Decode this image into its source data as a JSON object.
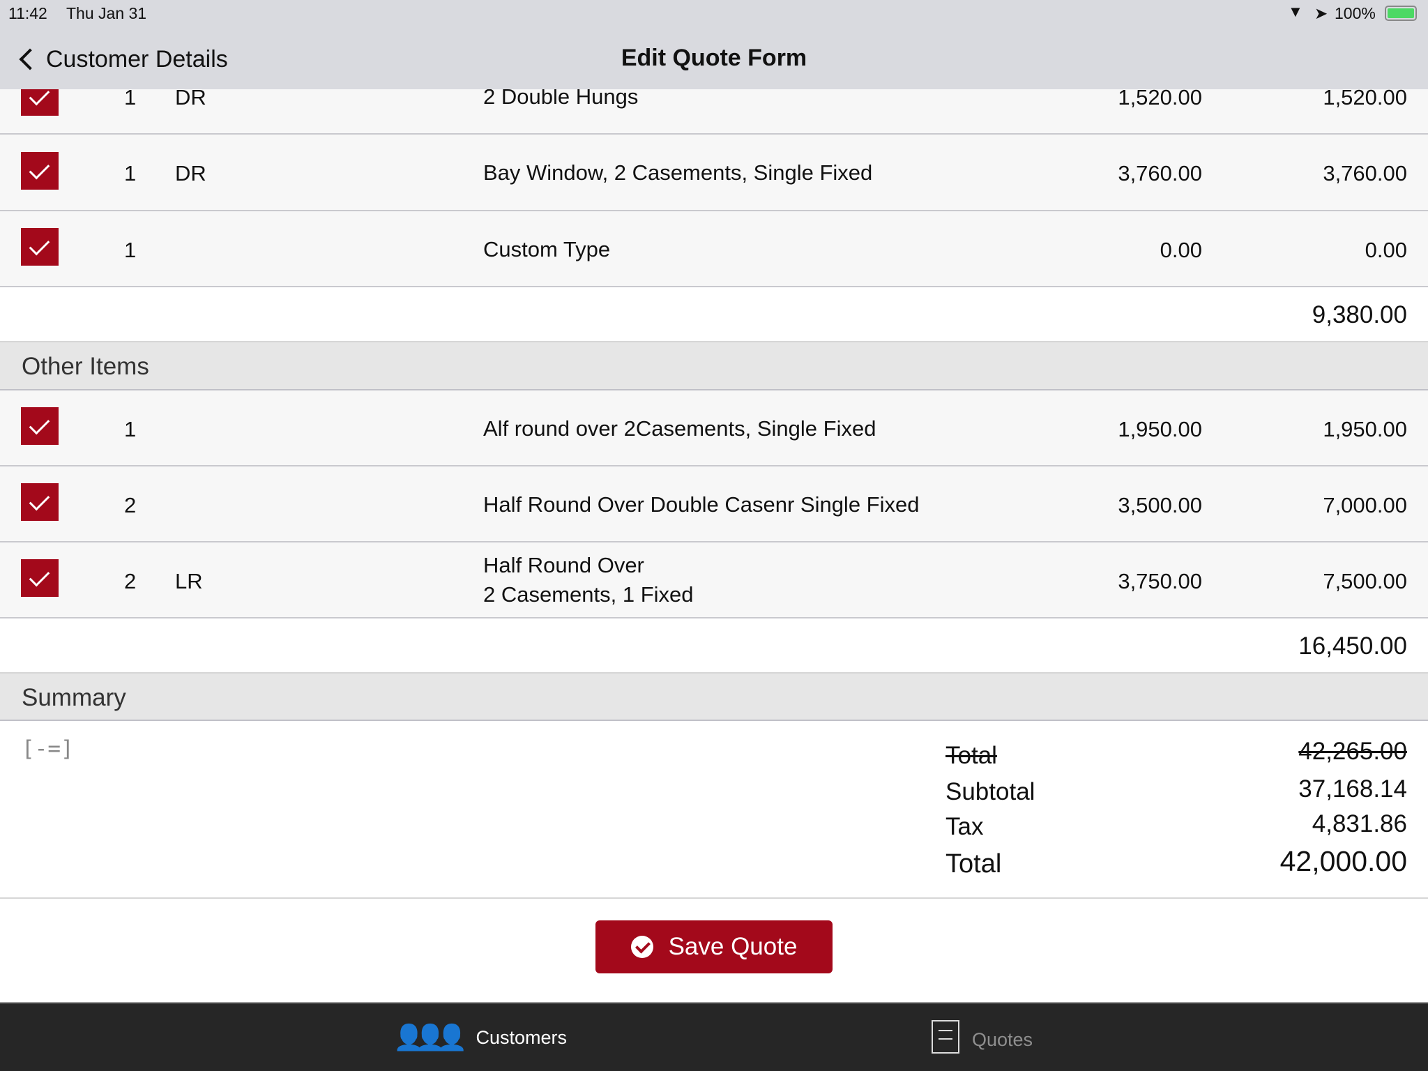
{
  "status": {
    "time": "11:42",
    "date": "Thu Jan 31",
    "battery": "100%"
  },
  "nav": {
    "back": "Customer Details",
    "title": "Edit Quote Form"
  },
  "section1": {
    "rows": [
      {
        "qty": "1",
        "code": "DR",
        "desc": "2 Double Hungs",
        "price": "1,520.00",
        "total": "1,520.00",
        "checked": true
      },
      {
        "qty": "1",
        "code": "DR",
        "desc": "Bay Window, 2 Casements, Single Fixed",
        "price": "3,760.00",
        "total": "3,760.00",
        "checked": true
      },
      {
        "qty": "1",
        "code": "",
        "desc": "Custom Type",
        "price": "0.00",
        "total": "0.00",
        "checked": true
      }
    ],
    "subtotal": "9,380.00"
  },
  "other": {
    "title": "Other Items",
    "rows": [
      {
        "qty": "1",
        "code": "",
        "desc": "Alf round over 2Casements, Single Fixed",
        "price": "1,950.00",
        "total": "1,950.00",
        "checked": true
      },
      {
        "qty": "2",
        "code": "",
        "desc": "Half Round Over Double Casenr Single Fixed",
        "price": "3,500.00",
        "total": "7,000.00",
        "checked": true
      },
      {
        "qty": "2",
        "code": "LR",
        "desc": "Half Round Over",
        "desc2": "2 Casements, 1 Fixed",
        "price": "3,750.00",
        "total": "7,500.00",
        "checked": true
      }
    ],
    "subtotal": "16,450.00"
  },
  "summary": {
    "title": "Summary",
    "toggle": "[-=]",
    "orig_label": "Total",
    "orig_value": "42,265.00",
    "subtotal_label": "Subtotal",
    "subtotal_value": "37,168.14",
    "tax_label": "Tax",
    "tax_value": "4,831.86",
    "total_label": "Total",
    "total_value": "42,000.00"
  },
  "save": "Save Quote",
  "tabs": {
    "customers": "Customers",
    "quotes": "Quotes"
  },
  "colors": {
    "accent": "#a3091b",
    "tabbar": "#262626"
  }
}
